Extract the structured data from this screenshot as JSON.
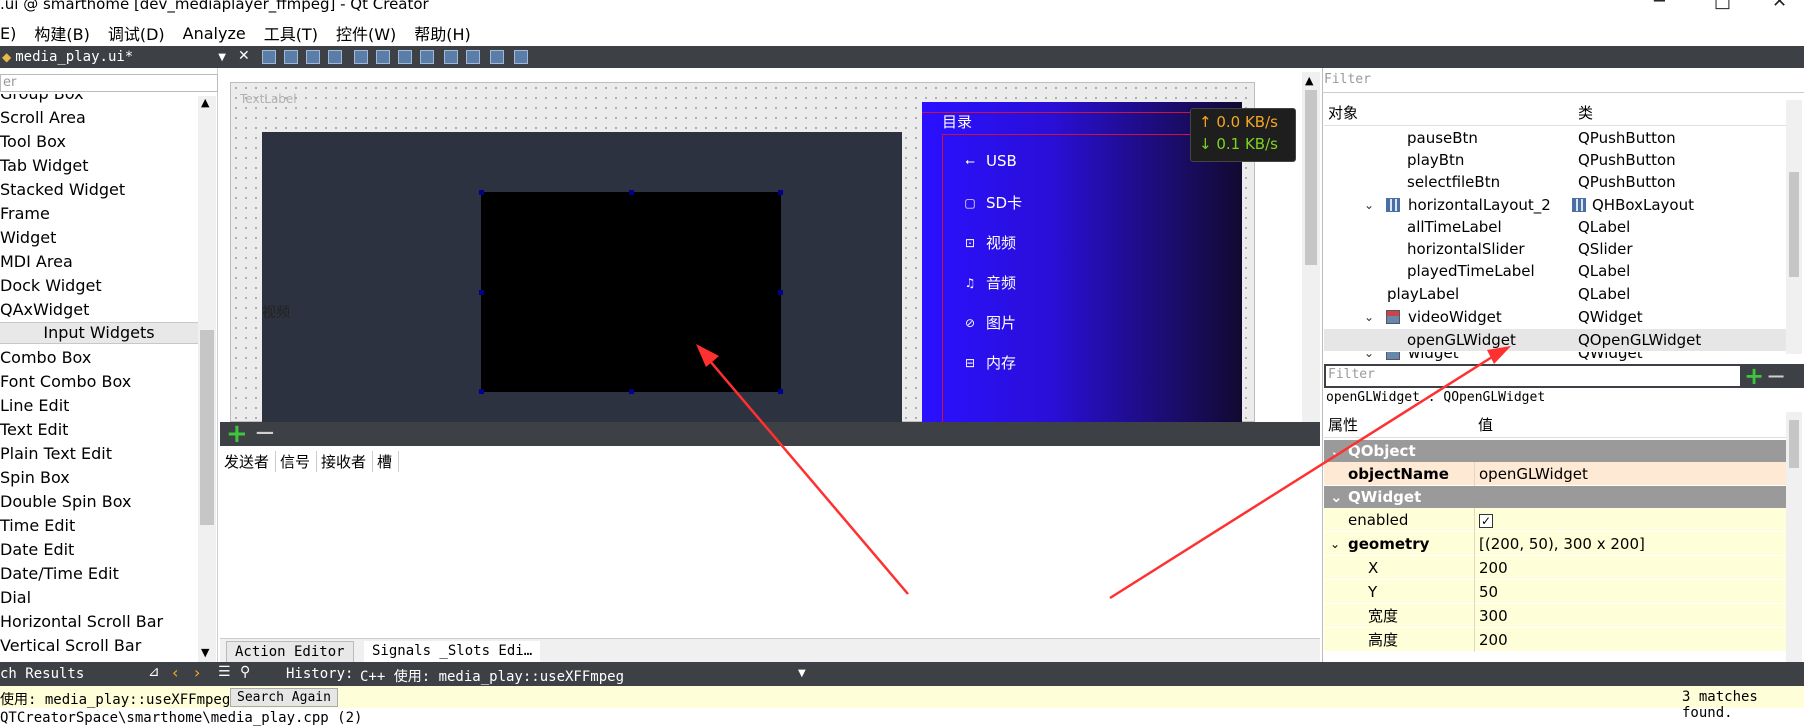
{
  "window": {
    "title": ".ui @ smarthome [dev_mediaplayer_ffmpeg] - Qt Creator",
    "minimize": "─",
    "maximize": "□",
    "close": "✕"
  },
  "menubar": [
    "E)",
    "构建(B)",
    "调试(D)",
    "Analyze",
    "工具(T)",
    "控件(W)",
    "帮助(H)"
  ],
  "toolbar": {
    "file_tab": "media_play.ui*",
    "close_glyph": "✕"
  },
  "widget_box": {
    "filter_placeholder": "er",
    "items_top": [
      "Group Box",
      "Scroll Area",
      "Tool Box",
      "Tab Widget",
      "Stacked Widget",
      "Frame",
      "Widget",
      "MDI Area",
      "Dock Widget",
      "QAxWidget"
    ],
    "category": "Input Widgets",
    "items_input": [
      "Combo Box",
      "Font Combo Box",
      "Line Edit",
      "Text Edit",
      "Plain Text Edit",
      "Spin Box",
      "Double Spin Box",
      "Time Edit",
      "Date Edit",
      "Date/Time Edit",
      "Dial",
      "Horizontal Scroll Bar",
      "Vertical Scroll Bar"
    ]
  },
  "form": {
    "text_label": "TextLabel",
    "video_label": "视频",
    "menu_title": "目录",
    "menu_items": [
      {
        "icon": "usb-icon",
        "glyph": "⭠",
        "label": "USB"
      },
      {
        "icon": "sdcard-icon",
        "glyph": "▢",
        "label": "SD卡"
      },
      {
        "icon": "video-icon",
        "glyph": "⊡",
        "label": "视频"
      },
      {
        "icon": "music-icon",
        "glyph": "♫",
        "label": "音频"
      },
      {
        "icon": "image-icon",
        "glyph": "⊘",
        "label": "图片"
      },
      {
        "icon": "storage-icon",
        "glyph": "⊟",
        "label": "内存"
      }
    ],
    "net_up": "↑ 0.0 KB/s",
    "net_down": "↓ 0.1 KB/s"
  },
  "signals_editor": {
    "columns": [
      "发送者",
      "信号",
      "接收者",
      "槽"
    ],
    "tabs": [
      "Action Editor",
      "Signals _Slots Edi…"
    ]
  },
  "object_inspector": {
    "filter_placeholder": "Filter",
    "col_object": "对象",
    "col_class": "类",
    "rows": [
      {
        "name": "pauseBtn",
        "cls": "QPushButton",
        "indent": 70
      },
      {
        "name": "playBtn",
        "cls": "QPushButton",
        "indent": 70
      },
      {
        "name": "selectfileBtn",
        "cls": "QPushButton",
        "indent": 70
      },
      {
        "name": "horizontalLayout_2",
        "cls": "QHBoxLayout",
        "indent": 72
      },
      {
        "name": "allTimeLabel",
        "cls": "QLabel",
        "indent": 70
      },
      {
        "name": "horizontalSlider",
        "cls": "QSlider",
        "indent": 70
      },
      {
        "name": "playedTimeLabel",
        "cls": "QLabel",
        "indent": 70
      },
      {
        "name": "playLabel",
        "cls": "QLabel",
        "indent": 52
      },
      {
        "name": "videoWidget",
        "cls": "QWidget",
        "indent": 72
      },
      {
        "name": "openGLWidget",
        "cls": "QOpenGLWidget",
        "indent": 70
      },
      {
        "name": "widget",
        "cls": "QWidget",
        "indent": 72
      }
    ]
  },
  "property_editor": {
    "filter_placeholder": "Filter",
    "class_line": "openGLWidget : QOpenGLWidget",
    "col_property": "属性",
    "col_value": "值",
    "cat_qobject": "QObject",
    "cat_qwidget": "QWidget",
    "rows": [
      {
        "key": "objectName",
        "value": "openGLWidget"
      },
      {
        "key": "enabled",
        "value": "✓"
      },
      {
        "key": "geometry",
        "value": "[(200, 50), 300 x 200]"
      },
      {
        "key": "X",
        "value": "200"
      },
      {
        "key": "Y",
        "value": "50"
      },
      {
        "key": "宽度",
        "value": "300"
      },
      {
        "key": "高度",
        "value": "200"
      }
    ]
  },
  "search": {
    "title": "ch Results",
    "history_label": "History:",
    "history_value": "C++ 使用: media_play::useXFFmpeg",
    "query": "使用: media_play::useXFFmpeg",
    "again_button": "Search Again",
    "matches": "3 matches found.",
    "path": "QTCreatorSpace\\smarthome\\media_play.cpp (2)"
  },
  "colors": {
    "dark_bar": "#3d4044",
    "menu_gradient_start": "#2a10ff",
    "arrow": "#ff3030"
  }
}
